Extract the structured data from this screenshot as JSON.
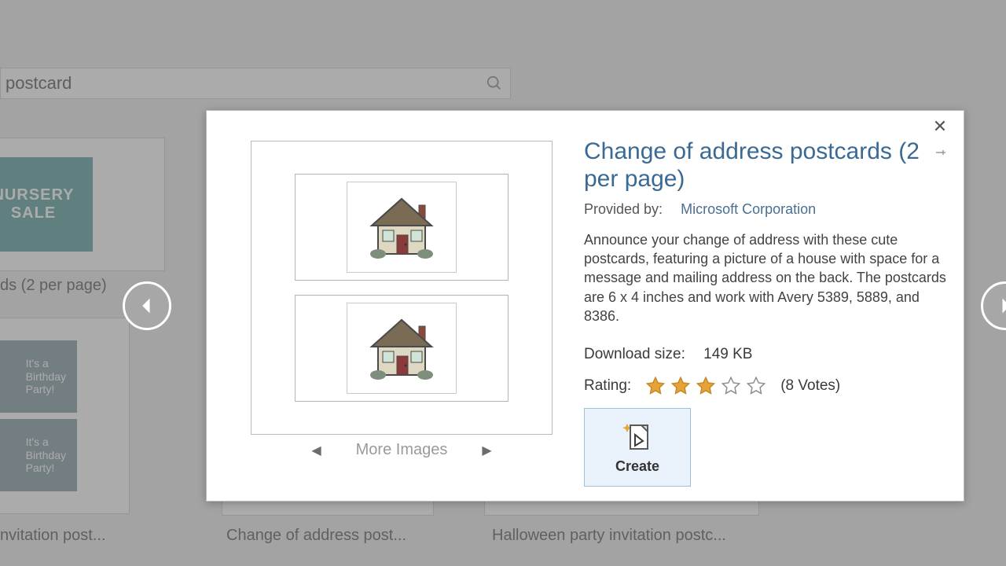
{
  "search": {
    "value": "postcard"
  },
  "background_thumbs": {
    "nursery_line1": "NURSERY",
    "nursery_line2": "SALE",
    "label1": "ds (2 per page)",
    "bday_text": "It's a\nBirthday\nParty!",
    "label2": "nvitation post...",
    "label3": "Change of address post...",
    "label4": "Halloween party invitation postc..."
  },
  "dialog": {
    "title": "Change of address postcards (2 per page)",
    "provided_label": "Provided by:",
    "provided_name": "Microsoft Corporation",
    "description": "Announce your change of address with these cute postcards, featuring a picture of a house with space for a message and mailing address on the back. The postcards are 6 x 4 inches and work with Avery 5389, 5889, and 8386.",
    "download_label": "Download size:",
    "download_value": "149 KB",
    "rating_label": "Rating:",
    "rating_stars": 3,
    "rating_max": 5,
    "votes": "(8 Votes)",
    "more_images": "More Images",
    "create": "Create"
  }
}
